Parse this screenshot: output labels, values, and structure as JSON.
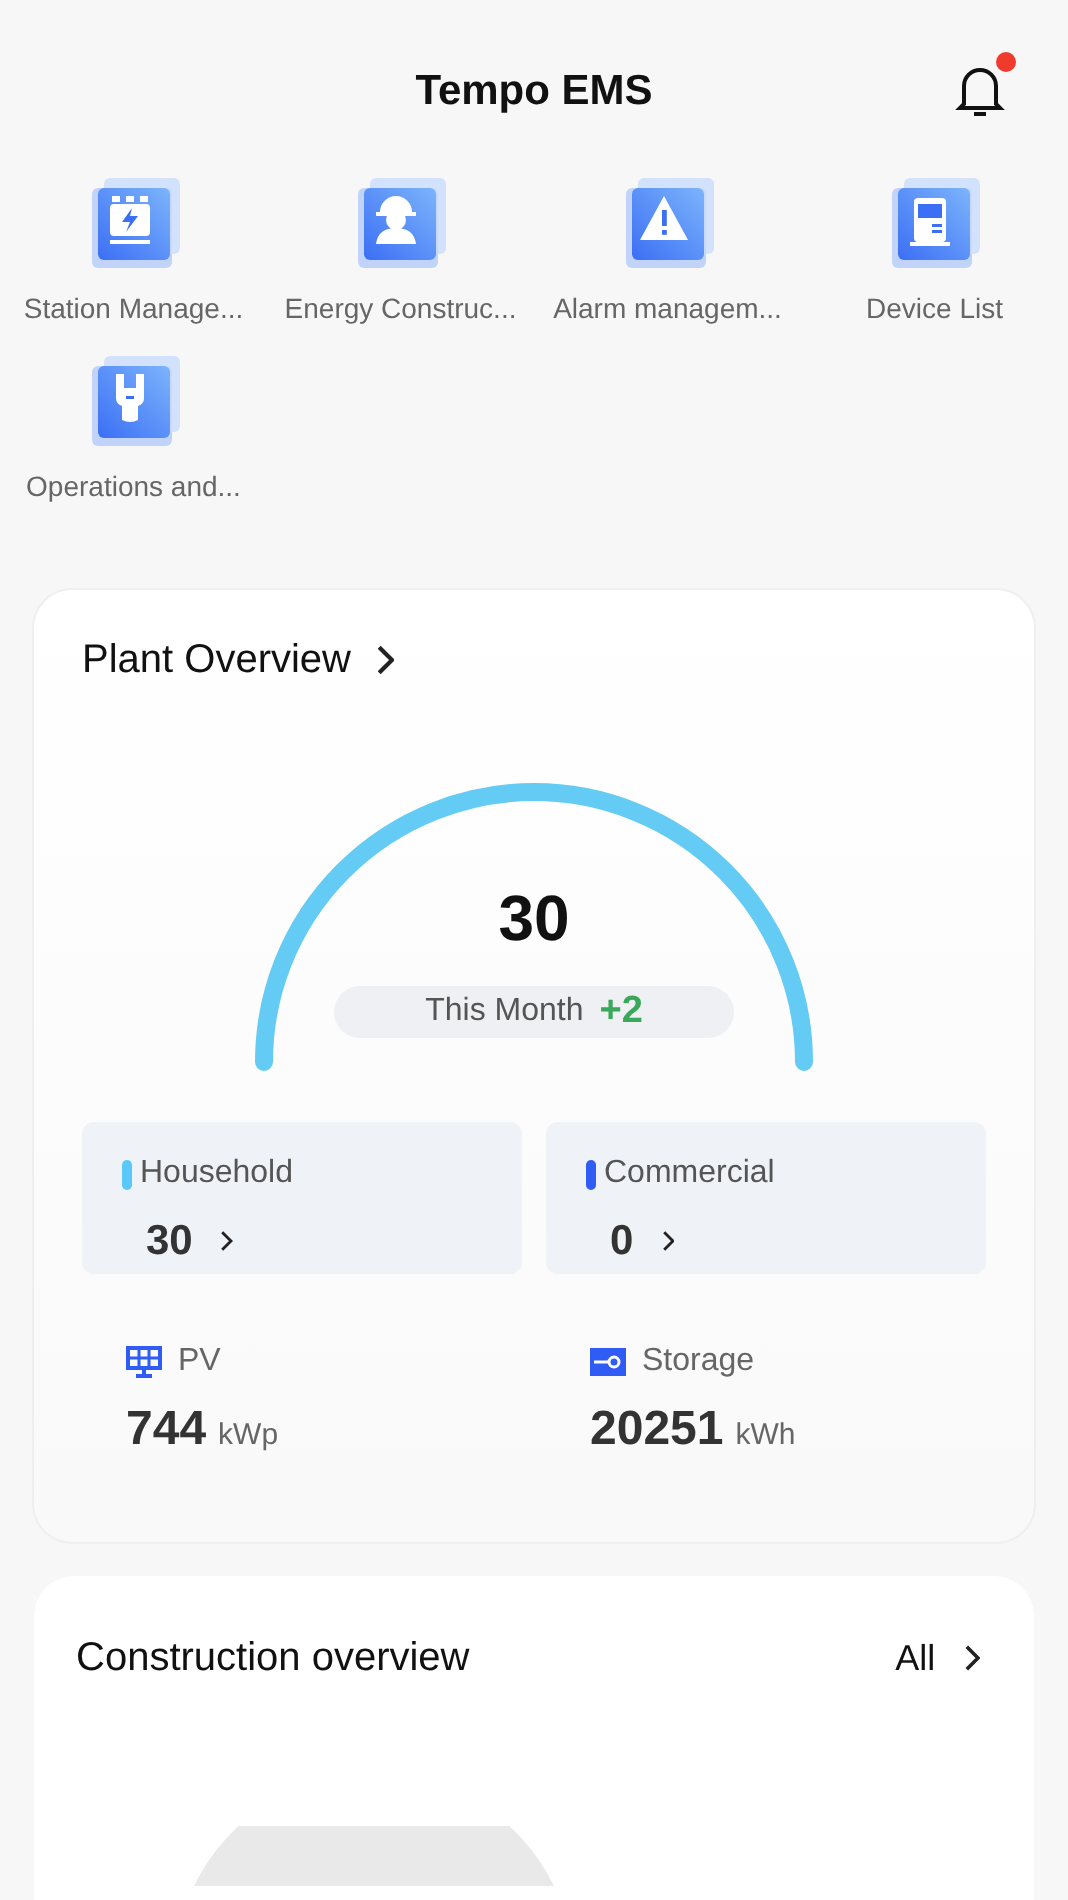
{
  "header": {
    "title": "Tempo EMS",
    "notification_dot": true
  },
  "shortcuts": [
    {
      "kind": "station",
      "label": "Station Manage..."
    },
    {
      "kind": "worker",
      "label": "Energy Construc..."
    },
    {
      "kind": "alarm",
      "label": "Alarm managem..."
    },
    {
      "kind": "device",
      "label": "Device List"
    },
    {
      "kind": "wrench",
      "label": "Operations and..."
    }
  ],
  "plant_overview": {
    "title": "Plant Overview",
    "total": "30",
    "period_label": "This Month",
    "period_change": "+2",
    "categories": [
      {
        "label": "Household",
        "value": "30",
        "color": "#5ac8fa"
      },
      {
        "label": "Commercial",
        "value": "0",
        "color": "#2f5cf5"
      }
    ],
    "capacities": [
      {
        "kind": "pv",
        "label": "PV",
        "value": "744",
        "unit": "kWp"
      },
      {
        "kind": "storage",
        "label": "Storage",
        "value": "20251",
        "unit": "kWh"
      }
    ]
  },
  "construction_overview": {
    "title": "Construction overview",
    "link": "All"
  }
}
